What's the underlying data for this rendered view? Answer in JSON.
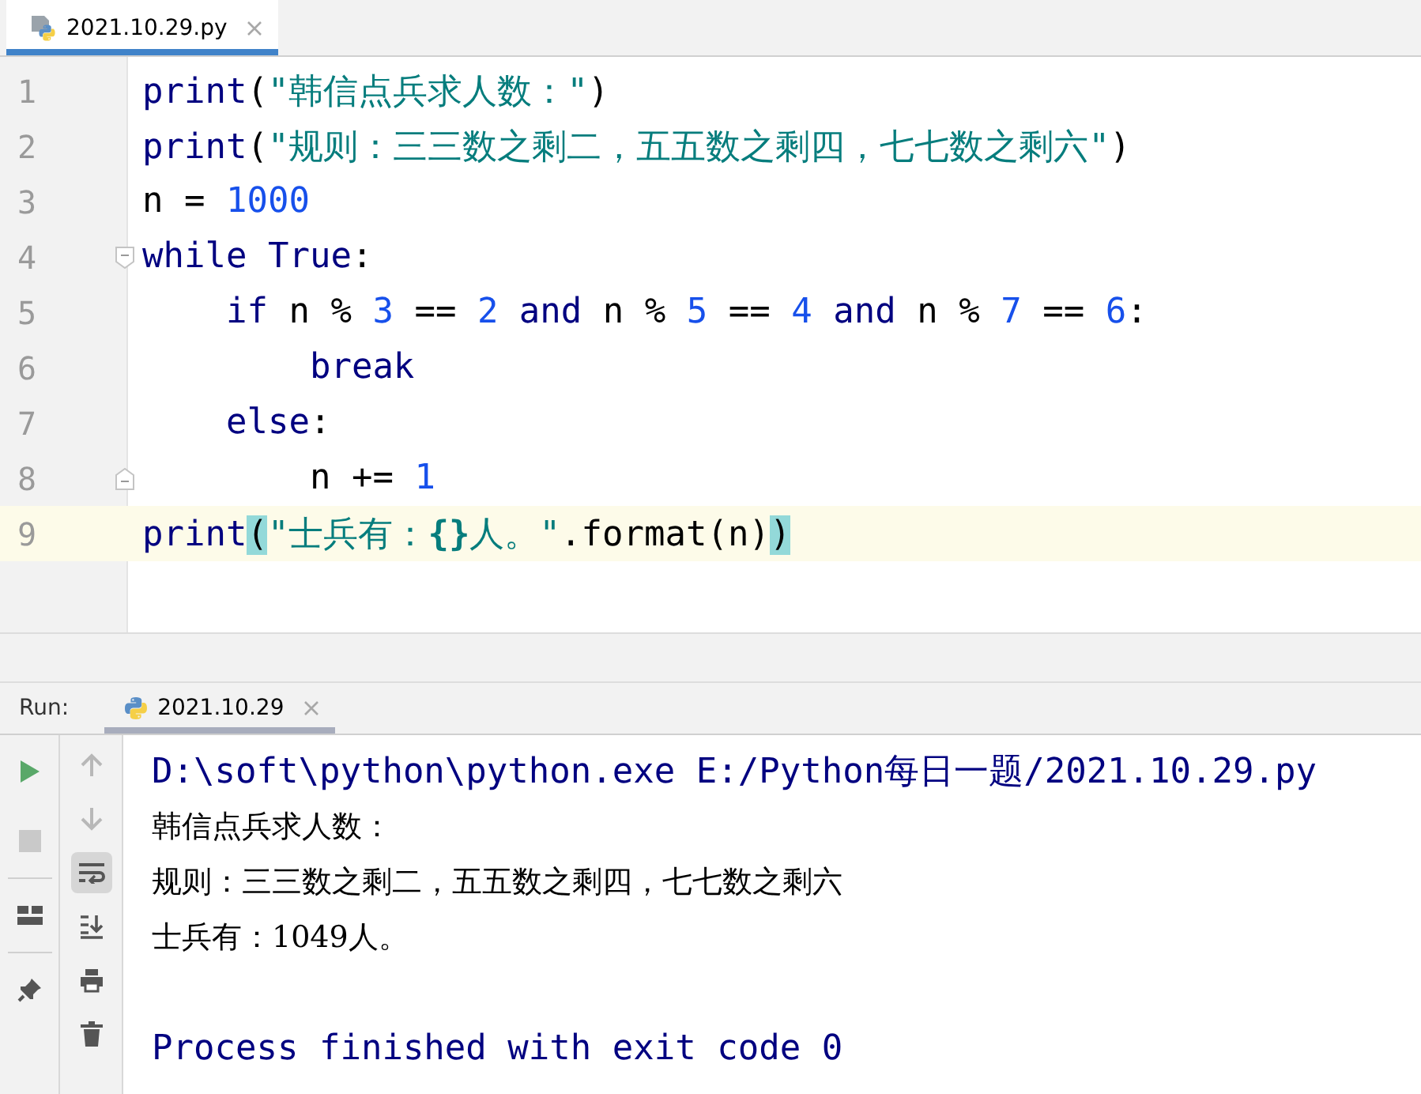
{
  "editor": {
    "tabs": [
      {
        "label": "2021.10.29.py",
        "selected": true
      }
    ],
    "lines": [
      {
        "number": "1",
        "current": false,
        "tokens": [
          {
            "text": "print",
            "kind": "builtin"
          },
          {
            "text": "(",
            "kind": "plain"
          },
          {
            "text": "\"韩信点兵求人数：\"",
            "kind": "string"
          },
          {
            "text": ")",
            "kind": "plain"
          }
        ]
      },
      {
        "number": "2",
        "current": false,
        "tokens": [
          {
            "text": "print",
            "kind": "builtin"
          },
          {
            "text": "(",
            "kind": "plain"
          },
          {
            "text": "\"规则：三三数之剩二，五五数之剩四，七七数之剩六\"",
            "kind": "string"
          },
          {
            "text": ")",
            "kind": "plain"
          }
        ]
      },
      {
        "number": "3",
        "current": false,
        "tokens": [
          {
            "text": "n = ",
            "kind": "plain"
          },
          {
            "text": "1000",
            "kind": "number"
          }
        ]
      },
      {
        "number": "4",
        "current": false,
        "fold_start": true,
        "tokens": [
          {
            "text": "while True",
            "kind": "keyword"
          },
          {
            "text": ":",
            "kind": "plain"
          }
        ],
        "children": [
          {
            "number": "5",
            "current": false,
            "tokens": [
              {
                "text": "if",
                "kind": "keyword"
              },
              {
                "text": " n % ",
                "kind": "plain"
              },
              {
                "text": "3",
                "kind": "number"
              },
              {
                "text": " == ",
                "kind": "plain"
              },
              {
                "text": "2",
                "kind": "number"
              },
              {
                "text": " and",
                "kind": "keyword"
              },
              {
                "text": " n % ",
                "kind": "plain"
              },
              {
                "text": "5",
                "kind": "number"
              },
              {
                "text": " == ",
                "kind": "plain"
              },
              {
                "text": "4",
                "kind": "number"
              },
              {
                "text": " and",
                "kind": "keyword"
              },
              {
                "text": " n % ",
                "kind": "plain"
              },
              {
                "text": "7",
                "kind": "number"
              },
              {
                "text": " == ",
                "kind": "plain"
              },
              {
                "text": "6",
                "kind": "number"
              },
              {
                "text": ":",
                "kind": "plain"
              }
            ],
            "children": [
              {
                "number": "6",
                "current": false,
                "tokens": [
                  {
                    "text": "break",
                    "kind": "keyword"
                  }
                ]
              }
            ]
          },
          {
            "number": "7",
            "current": false,
            "tokens": [
              {
                "text": "else",
                "kind": "keyword"
              },
              {
                "text": ":",
                "kind": "plain"
              }
            ],
            "children": [
              {
                "number": "8",
                "current": false,
                "fold_end": true,
                "tokens": [
                  {
                    "text": "n += ",
                    "kind": "plain"
                  },
                  {
                    "text": "1",
                    "kind": "number"
                  }
                ]
              }
            ]
          }
        ]
      },
      {
        "number": "9",
        "current": true,
        "tokens": [
          {
            "text": "print",
            "kind": "builtin"
          },
          {
            "text": "(",
            "kind": "match"
          },
          {
            "text": "\"士兵有：",
            "kind": "string"
          },
          {
            "text": "{}",
            "kind": "brace"
          },
          {
            "text": "人。\"",
            "kind": "string"
          },
          {
            "text": ".format(n)",
            "kind": "plain"
          },
          {
            "text": ")",
            "kind": "match"
          }
        ]
      }
    ]
  },
  "run": {
    "label": "Run:",
    "tabs": [
      {
        "label": "2021.10.29",
        "selected": true
      }
    ],
    "left_tools": [
      {
        "kind": "run"
      },
      {
        "kind": "stop"
      },
      {
        "kind": "layout"
      },
      {
        "kind": "pin"
      }
    ],
    "tools": [
      {
        "kind": "up",
        "on": false
      },
      {
        "kind": "down",
        "on": false
      },
      {
        "kind": "wrap",
        "on": true
      },
      {
        "kind": "scroll-end",
        "on": false
      },
      {
        "kind": "print",
        "on": false
      },
      {
        "kind": "trash",
        "on": false
      }
    ],
    "output": [
      {
        "text": "D:\\soft\\python\\python.exe E:/Python每日一题/2021.10.29.py",
        "kind": "system"
      },
      {
        "text": "韩信点兵求人数：",
        "kind": "stdout"
      },
      {
        "text": "规则：三三数之剩二，五五数之剩四，七七数之剩六",
        "kind": "stdout"
      },
      {
        "text": "士兵有：1049人。",
        "kind": "stdout"
      },
      {
        "text": "Process finished with exit code 0",
        "kind": "system",
        "gap": true
      }
    ]
  }
}
